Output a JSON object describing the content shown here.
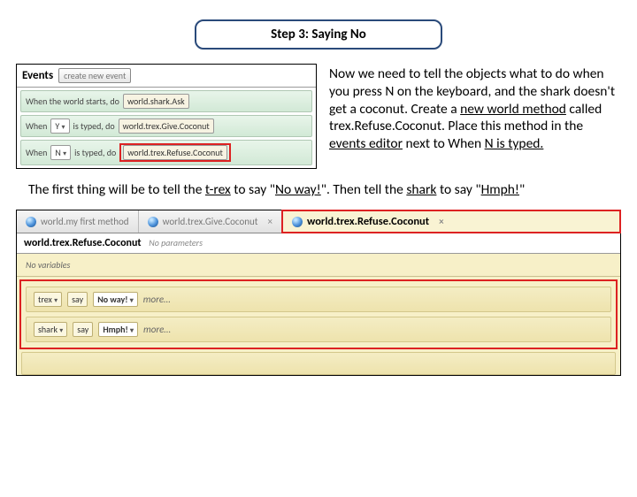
{
  "step": {
    "title": "Step 3: Saying No"
  },
  "events": {
    "heading": "Events",
    "create_label": "create new event",
    "rows": [
      {
        "prefix": "When the world starts, do",
        "method": "world.shark.Ask"
      },
      {
        "prefix": "When",
        "key": "Y",
        "mid": "is typed, do",
        "method": "world.trex.Give.Coconut"
      },
      {
        "prefix": "When",
        "key": "N",
        "mid": "is typed, do",
        "method": "world.trex.Refuse.Coconut"
      }
    ]
  },
  "instruction": {
    "p1": "Now we need to tell the objects what to do when you press N on the keyboard, and the shark doesn't get a coconut. Create a ",
    "u1": "new world method",
    "p2": " called trex.Refuse.Coconut. Place this method in the ",
    "u2": "events editor",
    "p3": " next to When ",
    "u3": "N is typed.",
    "line2a": "The first thing will be to tell the ",
    "line2u1": "t-rex",
    "line2b": " to say \"",
    "line2u2": "No way!",
    "line2c": "\". Then tell the ",
    "line2u3": "shark",
    "line2d": " to say \"",
    "line2u4": "Hmph!",
    "line2e": "\""
  },
  "tabs": [
    {
      "label": "world.my first method"
    },
    {
      "label": "world.trex.Give.Coconut"
    },
    {
      "label": "world.trex.Refuse.Coconut",
      "active": true
    }
  ],
  "method": {
    "name": "world.trex.Refuse.Coconut",
    "noparams": "No parameters",
    "novars": "No variables"
  },
  "code": [
    {
      "obj": "trex",
      "action": "say",
      "arg": "No way!",
      "more": "more…"
    },
    {
      "obj": "shark",
      "action": "say",
      "arg": "Hmph!",
      "more": "more…"
    }
  ]
}
